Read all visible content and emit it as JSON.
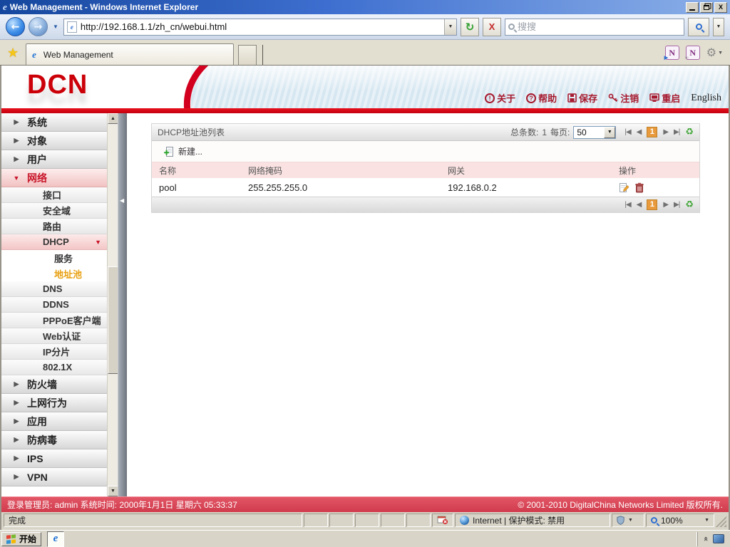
{
  "window": {
    "title": "Web Management - Windows Internet Explorer"
  },
  "nav": {
    "url": "http://192.168.1.1/zh_cn/webui.html",
    "search_placeholder": "搜搜"
  },
  "tabs": {
    "active": "Web Management"
  },
  "banner": {
    "logo": "DCN",
    "links": [
      {
        "id": "about",
        "label": "关于"
      },
      {
        "id": "help",
        "label": "帮助"
      },
      {
        "id": "save",
        "label": "保存"
      },
      {
        "id": "logout",
        "label": "注销"
      },
      {
        "id": "reboot",
        "label": "重启"
      }
    ],
    "english": "English"
  },
  "sidebar": {
    "items": [
      {
        "id": "system",
        "label": "系统",
        "level": 1,
        "state": "collapsed"
      },
      {
        "id": "objects",
        "label": "对象",
        "level": 1,
        "state": "collapsed"
      },
      {
        "id": "users",
        "label": "用户",
        "level": 1,
        "state": "collapsed"
      },
      {
        "id": "network",
        "label": "网络",
        "level": 1,
        "state": "expanded",
        "active": true
      },
      {
        "id": "interface",
        "label": "接口",
        "level": 2
      },
      {
        "id": "security-zone",
        "label": "安全域",
        "level": 2
      },
      {
        "id": "routing",
        "label": "路由",
        "level": 2
      },
      {
        "id": "dhcp",
        "label": "DHCP",
        "level": 2,
        "state": "expanded",
        "active": true
      },
      {
        "id": "service",
        "label": "服务",
        "level": 3
      },
      {
        "id": "address-pool",
        "label": "地址池",
        "level": 3,
        "selected": true
      },
      {
        "id": "dns",
        "label": "DNS",
        "level": 2
      },
      {
        "id": "ddns",
        "label": "DDNS",
        "level": 2
      },
      {
        "id": "pppoe-client",
        "label": "PPPoE客户端",
        "level": 2
      },
      {
        "id": "web-auth",
        "label": "Web认证",
        "level": 2
      },
      {
        "id": "ip-fragment",
        "label": "IP分片",
        "level": 2
      },
      {
        "id": "dot1x",
        "label": "802.1X",
        "level": 2
      },
      {
        "id": "firewall",
        "label": "防火墙",
        "level": 1,
        "state": "collapsed"
      },
      {
        "id": "web-behavior",
        "label": "上网行为",
        "level": 1,
        "state": "collapsed"
      },
      {
        "id": "application",
        "label": "应用",
        "level": 1,
        "state": "collapsed"
      },
      {
        "id": "antivirus",
        "label": "防病毒",
        "level": 1,
        "state": "collapsed"
      },
      {
        "id": "ips",
        "label": "IPS",
        "level": 1,
        "state": "collapsed"
      },
      {
        "id": "vpn",
        "label": "VPN",
        "level": 1,
        "state": "collapsed"
      }
    ]
  },
  "content": {
    "panel_title": "DHCP地址池列表",
    "toolbar_new": "新建...",
    "stats": {
      "total_label": "总条数:",
      "total": "1",
      "per_page_label": "每页:",
      "per_page": "50"
    },
    "pager": {
      "current": "1"
    },
    "table": {
      "columns": [
        "名称",
        "网络掩码",
        "网关",
        "操作"
      ],
      "rows": [
        {
          "name": "pool",
          "mask": "255.255.255.0",
          "gateway": "192.168.0.2"
        }
      ]
    }
  },
  "footer": {
    "left": "登录管理员: admin 系统时间: 2000年1月1日 星期六 05:33:37",
    "right": "© 2001-2010 DigitalChina Networks Limited 版权所有."
  },
  "statusbar": {
    "done": "完成",
    "zone": "Internet | 保护模式: 禁用",
    "zoom_value": "100%"
  },
  "taskbar": {
    "start_label": "开始"
  },
  "colors": {
    "brand_red": "#CC0008",
    "header_link_red": "#A6192E",
    "footer_red": "#D84B5B",
    "selected_orange": "#E8A010",
    "pager_current_bg": "#E89A3C",
    "refresh_green": "#3FA535"
  }
}
